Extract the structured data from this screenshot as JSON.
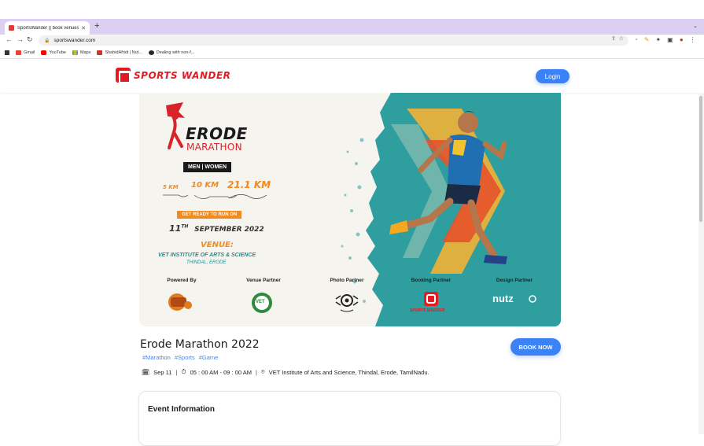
{
  "browser": {
    "tab_title": "SportsWander || book venues ...",
    "url": "sportswander.com",
    "bookmarks": [
      {
        "label": "Gmail",
        "icon": "gmail-icon",
        "color": "#ea4335"
      },
      {
        "label": "YouTube",
        "icon": "youtube-icon",
        "color": "#ff0000"
      },
      {
        "label": "Maps",
        "icon": "maps-icon",
        "color": "#34a853"
      },
      {
        "label": "ShahidAfridi | Nut...",
        "icon": "z-icon",
        "color": "#d93025"
      },
      {
        "label": "Dealing with non-f...",
        "icon": "github-icon",
        "color": "#24292e"
      }
    ]
  },
  "header": {
    "logo_text": "SPORTS WANDER",
    "login_label": "Login",
    "brand_color": "#e31b23",
    "accent_color": "#3b82f6"
  },
  "banner": {
    "title": "ERODE",
    "subtitle": "MARATHON",
    "category": "MEN | WOMEN",
    "distances": [
      "5 KM",
      "10 KM",
      "21.1 KM"
    ],
    "ready": "GET READY TO RUN ON",
    "date_day": "11",
    "date_suffix": "TH",
    "date_rest": "SEPTEMBER 2022",
    "venue_label": "VENUE:",
    "venue": "VET INSTITUTE OF ARTS & SCIENCE",
    "place": "THINDAL, ERODE",
    "partners": [
      {
        "label": "Powered By",
        "logo": "powered-by-logo"
      },
      {
        "label": "Venue Partner",
        "logo": "vet-logo"
      },
      {
        "label": "Photo Partner",
        "logo": "photo-partner-logo"
      },
      {
        "label": "Booking Partner",
        "logo": "sports-wander-logo"
      },
      {
        "label": "Design Partner",
        "logo": "nutz-logo"
      }
    ],
    "vet_text": "VET",
    "booking_logo_text": "SPORTS WANDER",
    "nutz_text": "nutz"
  },
  "event": {
    "title": "Erode Marathon 2022",
    "tags": [
      "#Marathon",
      "#Sports",
      "#Game"
    ],
    "date": "Sep 11",
    "time": "05 : 00 AM - 09 : 00 AM",
    "location": "VET Institute of Arts and Science, Thindal, Erode, TamilNadu.",
    "book_label": "BOOK NOW",
    "info_heading": "Event Information"
  }
}
